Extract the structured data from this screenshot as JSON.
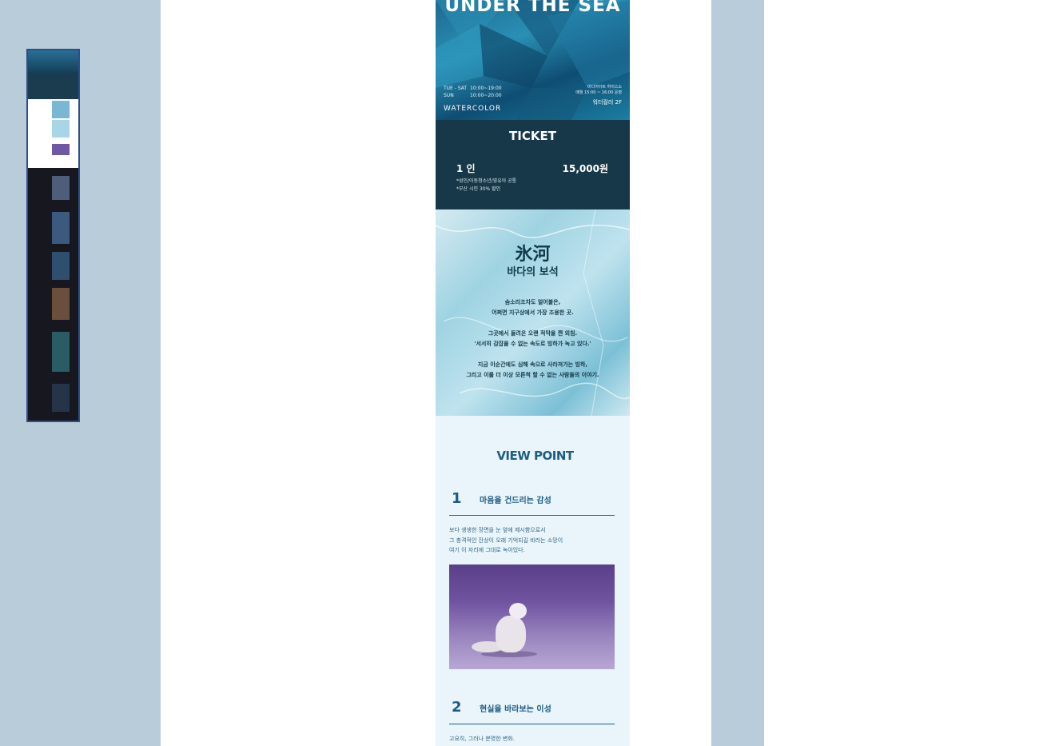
{
  "colors": {
    "rail": "#b9ccd9",
    "ticket_bg": "#163848",
    "viewpoint_bg": "#eaf5fb",
    "accent": "#1c5d85",
    "minimap_border": "#2b4f88"
  },
  "hero": {
    "title": "UNDER THE SEA",
    "hours": [
      {
        "day": "TUE - SAT",
        "time": "10:00~19:00"
      },
      {
        "day": "SUN",
        "time": "10:00~20:00"
      }
    ],
    "right_line1": "미디어아트 하이스소",
    "right_line2": "매월 15:00 ~ 16:00 운영",
    "floor": "워터컬러 2F",
    "logo": "WATERCOLOR"
  },
  "ticket": {
    "title": "TICKET",
    "person": "1 인",
    "price": "15,000원",
    "note1": "*성인/아동청소년/영유아 공통",
    "note2": "*부산 시민 30% 할인"
  },
  "glacier": {
    "hanja": "氷河",
    "subtitle": "바다의 보석",
    "paragraphs": [
      [
        "숨소리조차도 얼어붙은,",
        "어쩌면 지구상에서 가장 조용한 곳."
      ],
      [
        "그곳에서 들려온 오랜 적막을 깬 외침.",
        "'서서히 감잡을 수 없는 속도로 빙하가 녹고 있다.'"
      ],
      [
        "지금 이순간에도 심해 속으로 사라져가는 빙하,",
        "그리고 이를 더 이상 모른척 할 수 없는 사람들의 이야기."
      ]
    ]
  },
  "viewpoint": {
    "title": "VIEW POINT",
    "items": [
      {
        "num": "1",
        "heading": "마음을 건드리는 감성",
        "body": [
          "보다 생생한 장면을 눈 앞에 제시함으로서",
          "그 충격적인 잔상이 오래 기억되길 바라는 소망이",
          "여기 이 자리에 그대로 녹아있다."
        ]
      },
      {
        "num": "2",
        "heading": "현실을 바라보는 이성",
        "body": [
          "고요히, 그러나 분명한 변화."
        ]
      }
    ]
  }
}
